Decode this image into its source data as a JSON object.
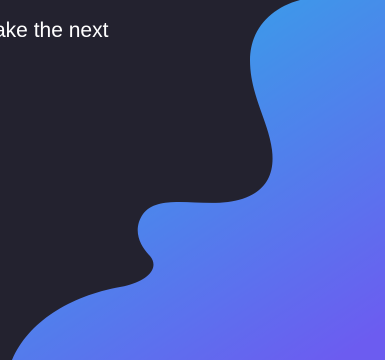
{
  "hero": {
    "headline_fragment": "ake the next"
  },
  "decor": {
    "blob_gradient_start": "#36a2e8",
    "blob_gradient_end": "#6c5cf0",
    "background": "#23222f"
  }
}
